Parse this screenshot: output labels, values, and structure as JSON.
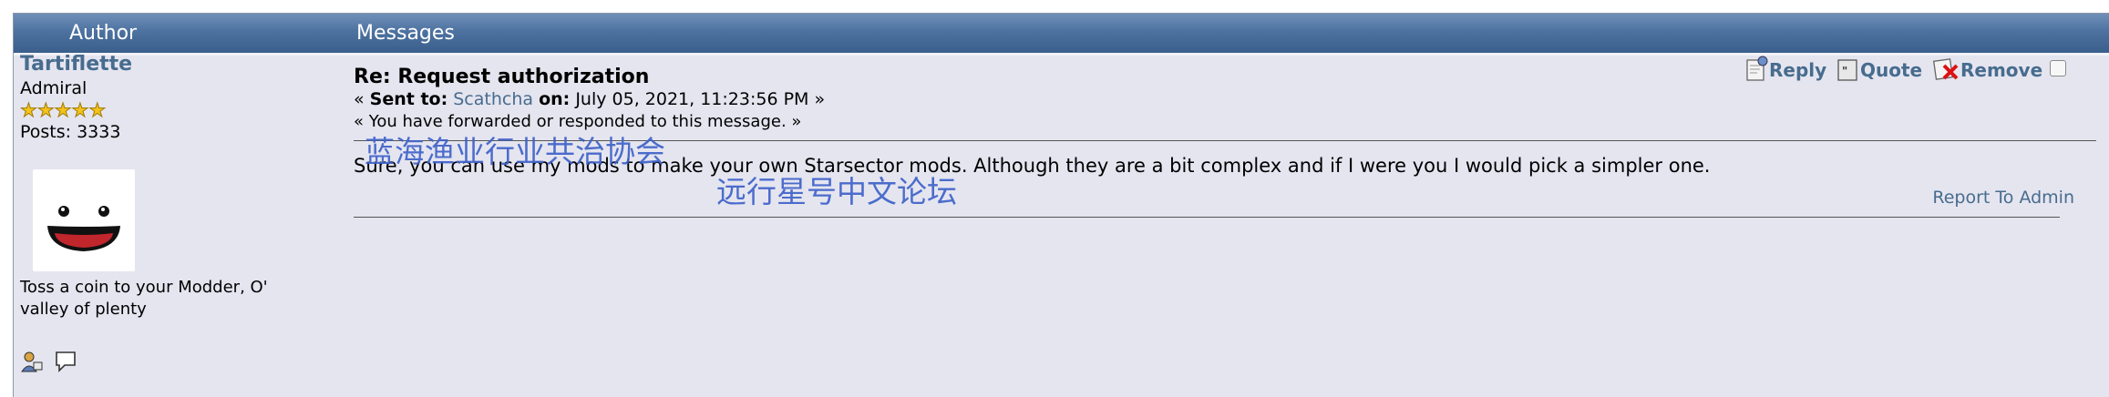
{
  "header": {
    "author_label": "Author",
    "messages_label": "Messages"
  },
  "author": {
    "name": "Tartiflette",
    "rank": "Admiral",
    "stars": 5,
    "posts": "Posts: 3333",
    "signature": "Toss a coin to your Modder, O' valley of plenty"
  },
  "message": {
    "subject": "Re: Request authorization",
    "sent_prefix": "« ",
    "sent_to_label": "Sent to:",
    "recipient": "Scathcha",
    "on_label": "on:",
    "date": "July 05, 2021, 11:23:56 PM »",
    "forwarded_note": "« You have forwarded or responded to this message. »",
    "body": "Sure, you can use my mods to make your own Starsector mods. Although they are a bit complex and if I were you I would pick a simpler one.",
    "report_link": "Report To Admin"
  },
  "actions": {
    "reply": "Reply",
    "quote": "Quote",
    "remove": "Remove"
  },
  "watermarks": {
    "line1": "蓝海渔业行业共治协会",
    "line2": "远行星号中文论坛"
  },
  "colors": {
    "header": "#4d72a0",
    "link": "#476c8e",
    "panel": "#e5e5f0",
    "watermark": "#3f62c8"
  }
}
